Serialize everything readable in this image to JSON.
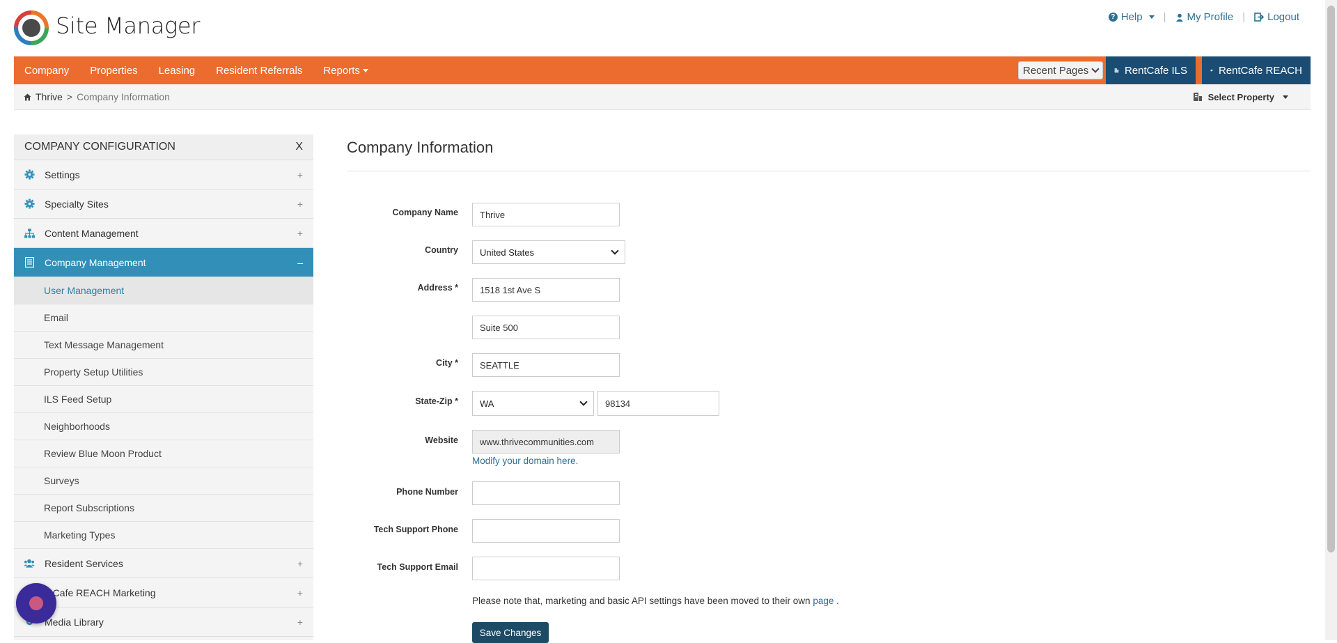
{
  "header": {
    "app_title": "Site Manager",
    "help_label": "Help",
    "profile_label": "My Profile",
    "logout_label": "Logout",
    "separator": "|"
  },
  "nav": {
    "items": [
      "Company",
      "Properties",
      "Leasing",
      "Resident Referrals",
      "Reports"
    ],
    "recent_pages": "Recent Pages",
    "ils_label": "RentCafe ILS",
    "reach_label": "RentCafe REACH"
  },
  "breadcrumb": {
    "home": "Thrive",
    "separator": ">",
    "current": "Company Information",
    "select_property": "Select Property"
  },
  "sidebar": {
    "title": "COMPANY CONFIGURATION",
    "close": "X",
    "groups_top": [
      {
        "label": "Settings",
        "sign": "+"
      },
      {
        "label": "Specialty Sites",
        "sign": "+"
      },
      {
        "label": "Content Management",
        "sign": "+"
      }
    ],
    "active_group": {
      "label": "Company Management",
      "sign": "–"
    },
    "subitems": [
      "User Management",
      "Email",
      "Text Message Management",
      "Property Setup Utilities",
      "ILS Feed Setup",
      "Neighborhoods",
      "Review Blue Moon Product",
      "Surveys",
      "Report Subscriptions",
      "Marketing Types"
    ],
    "groups_bottom": [
      {
        "label": "Resident Services",
        "sign": "+"
      },
      {
        "label": "ntCafe REACH Marketing",
        "sign": "+"
      },
      {
        "label": "Media Library",
        "sign": "+"
      }
    ]
  },
  "main": {
    "title": "Company Information",
    "labels": {
      "company_name": "Company Name",
      "country": "Country",
      "address": "Address *",
      "city": "City *",
      "state_zip": "State-Zip *",
      "website": "Website",
      "phone": "Phone Number",
      "tech_phone": "Tech Support Phone",
      "tech_email": "Tech Support Email"
    },
    "values": {
      "company_name": "Thrive",
      "country": "United States",
      "address1": "1518 1st Ave S",
      "address2": "Suite 500",
      "city": "SEATTLE",
      "state": "WA",
      "zip": "98134",
      "website": "www.thrivecommunities.com",
      "phone": "",
      "tech_phone": "",
      "tech_email": ""
    },
    "modify_link": "Modify your domain here.",
    "note_prefix": "Please note that, marketing and basic API settings have been moved to their own",
    "note_link": "page",
    "note_suffix": ".",
    "save_label": "Save Changes"
  },
  "colors": {
    "nav_orange": "#ec6c2f",
    "reach_blue": "#1b4c74",
    "active_teal": "#3290b8",
    "link_blue": "#2d6f92",
    "save_dark": "#1d4b66"
  }
}
